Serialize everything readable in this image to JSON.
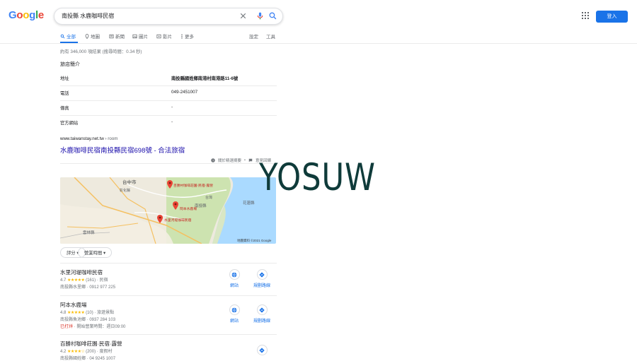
{
  "logo": {
    "letters": [
      {
        "ch": "G",
        "color": "#4285f4"
      },
      {
        "ch": "o",
        "color": "#ea4335"
      },
      {
        "ch": "o",
        "color": "#fbbc05"
      },
      {
        "ch": "g",
        "color": "#4285f4"
      },
      {
        "ch": "l",
        "color": "#34a853"
      },
      {
        "ch": "e",
        "color": "#ea4335"
      }
    ]
  },
  "search": {
    "query": "南投縣 水鹿咖啡民宿"
  },
  "header": {
    "signin_label": "登入"
  },
  "tabs": [
    {
      "label": "全部",
      "icon": "search-icon",
      "active": true
    },
    {
      "label": "地圖",
      "icon": "map-pin-icon"
    },
    {
      "label": "新聞",
      "icon": "news-icon"
    },
    {
      "label": "圖片",
      "icon": "image-icon"
    },
    {
      "label": "影片",
      "icon": "video-icon"
    },
    {
      "label": "更多",
      "icon": "more-icon"
    }
  ],
  "tools": {
    "settings": "設定",
    "tools": "工具"
  },
  "stats": "約有 346,000 項結果 (搜尋時間：0.34 秒)",
  "info": {
    "title": "旅店簡介",
    "rows": [
      {
        "key": "地址",
        "value": "南投縣國姓鄉南港村南港路11-6號",
        "bold": true
      },
      {
        "key": "電話",
        "value": "049-2451007"
      },
      {
        "key": "傳真",
        "value": "-"
      },
      {
        "key": "官方網站",
        "value": "-"
      }
    ]
  },
  "result": {
    "cite_domain": "www.taiwanstay.net.tw",
    "cite_path": " › room",
    "title": "水鹿咖啡民宿南投縣民宿698號 - 合法旅宿",
    "about": "關於精選摘要",
    "feedback": "意見回饋"
  },
  "map": {
    "labels": [
      "台中市",
      "彰化縣",
      "南投縣",
      "雲林縣",
      "花蓮縣",
      "台灣"
    ],
    "pins": [
      "百勝村咖啡莊園·民宿·露營",
      "阿本水鹿場",
      "水里河堤咖啡民宿"
    ],
    "copyright": "地圖資料 ©2021 Google"
  },
  "filters": [
    {
      "label": "評分"
    },
    {
      "label": "營業時間"
    }
  ],
  "places": [
    {
      "name": "水里河堤咖啡民宿",
      "rating": "4.7",
      "stars": "★★★★★",
      "reviews": "(161)",
      "type": "民宿",
      "line2": "南投縣水里鄉 · 0912 977 225",
      "line3": "",
      "website": "網站",
      "directions": "規劃路線"
    },
    {
      "name": "阿本水鹿場",
      "rating": "4.8",
      "stars": "★★★★★",
      "reviews": "(10)",
      "type": "旅遊景點",
      "line2": "南投縣魚池鄉 · 0937 284 103",
      "closed": "已打烊",
      "line3": " · 開始營業時間：週日09:00",
      "website": "網站",
      "directions": "規劃路線"
    },
    {
      "name": "百勝村咖啡莊園·民宿·露營",
      "rating": "4.2",
      "stars": "★★★★☆",
      "reviews": "(200)",
      "type": "度假村",
      "line2": "南投縣國姓鄉 · 04 9245 1007",
      "directions": "規劃路線"
    }
  ],
  "watermark": "YOSUW",
  "colors": {
    "accent": "#1a73e8",
    "link": "#1a0dab",
    "star": "#fbbc04",
    "closed": "#d93025"
  }
}
